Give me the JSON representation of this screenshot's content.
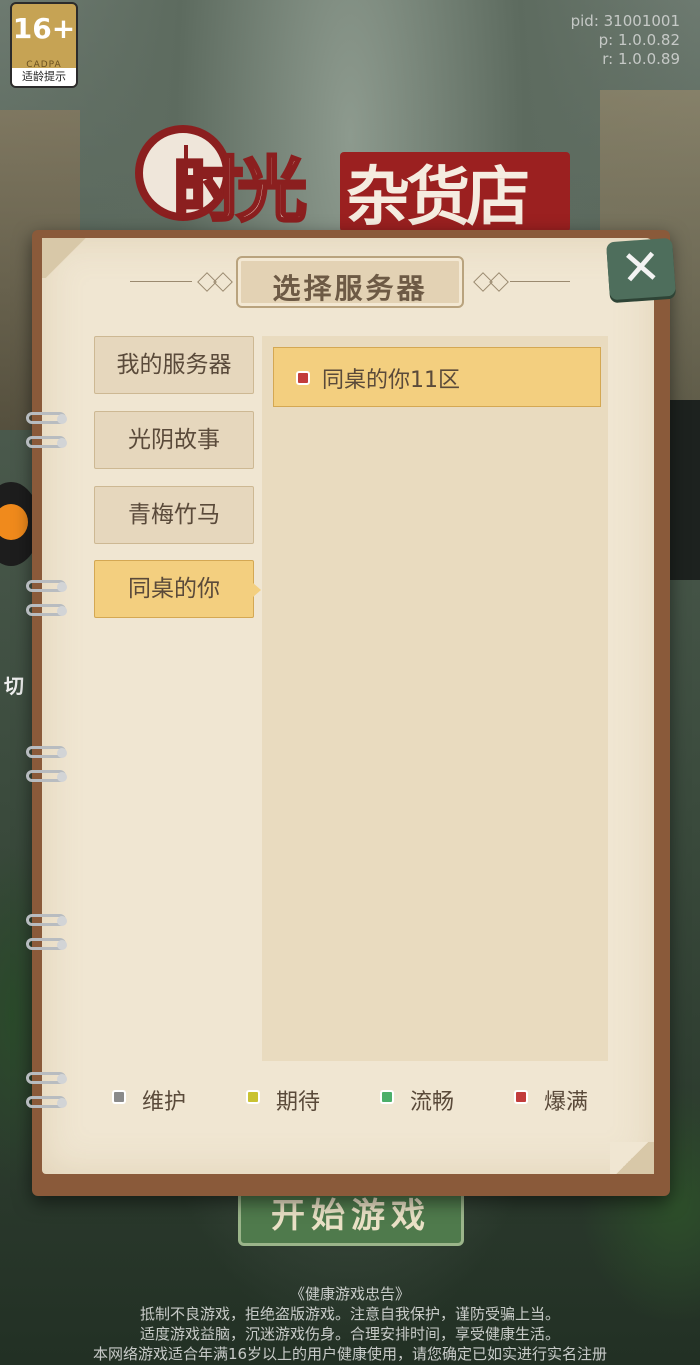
{
  "app": {
    "age_badge": {
      "number": "16+",
      "cadpa": "CADPA",
      "tip": "适龄提示"
    },
    "version": {
      "pid": "pid: 31001001",
      "p": "p: 1.0.0.82",
      "r": "r: 1.0.0.89"
    },
    "logo": {
      "part1": "时光",
      "part2": "杂货店"
    },
    "start_button": "开始游戏",
    "side_text": "切"
  },
  "dialog": {
    "title": "选择服务器",
    "close_symbol": "✕",
    "tabs": [
      {
        "label": "我的服务器",
        "active": false
      },
      {
        "label": "光阴故事",
        "active": false
      },
      {
        "label": "青梅竹马",
        "active": false
      },
      {
        "label": "同桌的你",
        "active": true
      }
    ],
    "servers": [
      {
        "name": "同桌的你11区",
        "status": "爆满"
      }
    ],
    "legend": [
      {
        "label": "维护",
        "color": "#8a8a8a"
      },
      {
        "label": "期待",
        "color": "#c9c232"
      },
      {
        "label": "流畅",
        "color": "#4caf6a"
      },
      {
        "label": "爆满",
        "color": "#c23c3c"
      }
    ]
  },
  "notice": {
    "title": "《健康游戏忠告》",
    "lines": [
      "抵制不良游戏，拒绝盗版游戏。注意自我保护，谨防受骗上当。",
      "适度游戏益脑，沉迷游戏伤身。合理安排时间，享受健康生活。",
      "本网络游戏适合年满16岁以上的用户健康使用，请您确定已如实进行实名注册"
    ]
  }
}
